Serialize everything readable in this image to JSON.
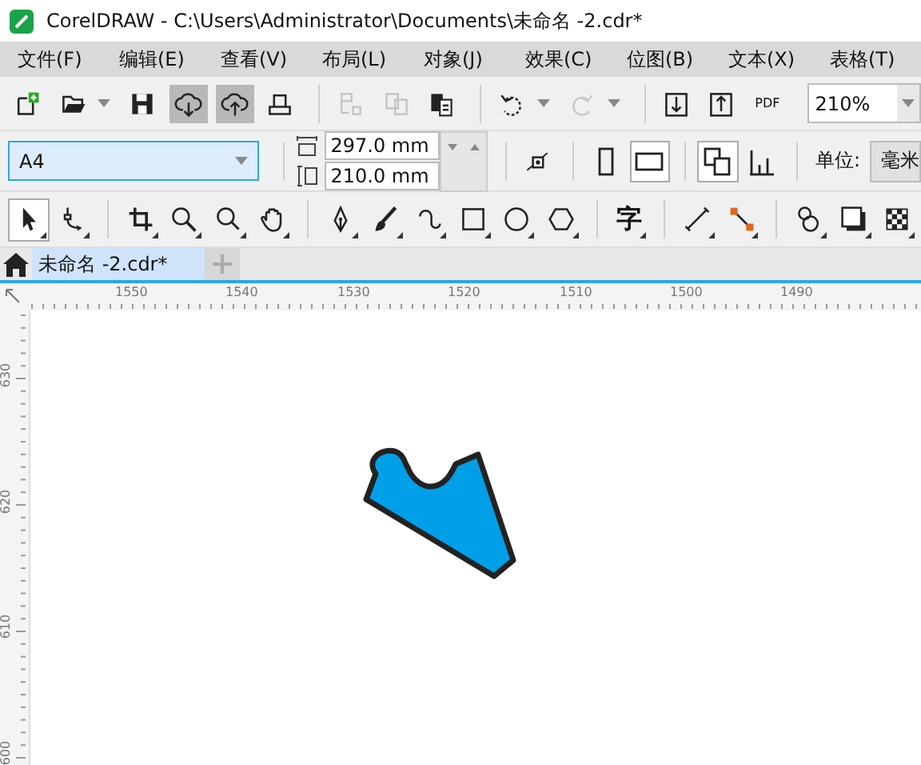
{
  "window": {
    "title": "CorelDRAW - C:\\Users\\Administrator\\Documents\\未命名 -2.cdr*"
  },
  "menu": [
    "文件(F)",
    "编辑(E)",
    "查看(V)",
    "布局(L)",
    "对象(J)",
    "效果(C)",
    "位图(B)",
    "文本(X)",
    "表格(T)"
  ],
  "toolbar": {
    "items": [
      {
        "kind": "new",
        "pressed": false,
        "disabled": false,
        "dropdown": false
      },
      {
        "kind": "open",
        "pressed": false,
        "disabled": false,
        "dropdown": true
      },
      {
        "kind": "save",
        "pressed": false,
        "disabled": false,
        "dropdown": false
      },
      {
        "kind": "download",
        "pressed": true,
        "disabled": false,
        "dropdown": false
      },
      {
        "kind": "upload",
        "pressed": true,
        "disabled": false,
        "dropdown": false
      },
      {
        "kind": "print",
        "pressed": false,
        "disabled": false,
        "dropdown": false
      },
      {
        "kind": "sep"
      },
      {
        "kind": "cut",
        "pressed": false,
        "disabled": true,
        "dropdown": false
      },
      {
        "kind": "copy",
        "pressed": false,
        "disabled": true,
        "dropdown": false
      },
      {
        "kind": "paste",
        "pressed": false,
        "disabled": false,
        "dropdown": false
      },
      {
        "kind": "sep"
      },
      {
        "kind": "undo",
        "pressed": false,
        "disabled": false,
        "dropdown": true
      },
      {
        "kind": "redo",
        "pressed": false,
        "disabled": true,
        "dropdown": true
      },
      {
        "kind": "sep"
      },
      {
        "kind": "import",
        "pressed": false,
        "disabled": false,
        "dropdown": false
      },
      {
        "kind": "export",
        "pressed": false,
        "disabled": false,
        "dropdown": false
      },
      {
        "kind": "pdf",
        "pressed": false,
        "disabled": false,
        "dropdown": false,
        "label": "PDF"
      }
    ],
    "zoom": "210%"
  },
  "property_bar": {
    "paper": "A4",
    "width": "297.0 mm",
    "height": "210.0 mm",
    "orientation": [
      {
        "kind": "portrait",
        "selected": false
      },
      {
        "kind": "landscape",
        "selected": true
      }
    ],
    "page_buttons": [
      {
        "kind": "pages",
        "selected": true
      },
      {
        "kind": "bars",
        "selected": false
      }
    ],
    "units_label": "单位:",
    "units": "毫米"
  },
  "toolbox": [
    {
      "kind": "pointer",
      "selected": true
    },
    {
      "kind": "node",
      "selected": false
    },
    {
      "kind": "sep"
    },
    {
      "kind": "crop",
      "selected": false
    },
    {
      "kind": "zoom",
      "selected": false
    },
    {
      "kind": "zoom2",
      "selected": false
    },
    {
      "kind": "hand",
      "selected": false
    },
    {
      "kind": "sep"
    },
    {
      "kind": "pen",
      "selected": false
    },
    {
      "kind": "brush",
      "selected": false
    },
    {
      "kind": "curve",
      "selected": false
    },
    {
      "kind": "rect",
      "selected": false
    },
    {
      "kind": "ellipse",
      "selected": false
    },
    {
      "kind": "polygon",
      "selected": false
    },
    {
      "kind": "sep"
    },
    {
      "kind": "text",
      "selected": false,
      "label": "字"
    },
    {
      "kind": "sep"
    },
    {
      "kind": "line",
      "selected": false
    },
    {
      "kind": "connector",
      "selected": false
    },
    {
      "kind": "sep"
    },
    {
      "kind": "blend",
      "selected": false
    },
    {
      "kind": "shadow",
      "selected": false
    },
    {
      "kind": "transparency",
      "selected": false
    }
  ],
  "tabs": [
    {
      "label": "未命名 -2.cdr*",
      "selected": true
    }
  ],
  "rulers": {
    "horizontal": [
      "1550",
      "1540",
      "1530",
      "1520",
      "1510",
      "1500",
      "1490"
    ],
    "vertical": [
      "630",
      "620",
      "610",
      "600"
    ]
  }
}
